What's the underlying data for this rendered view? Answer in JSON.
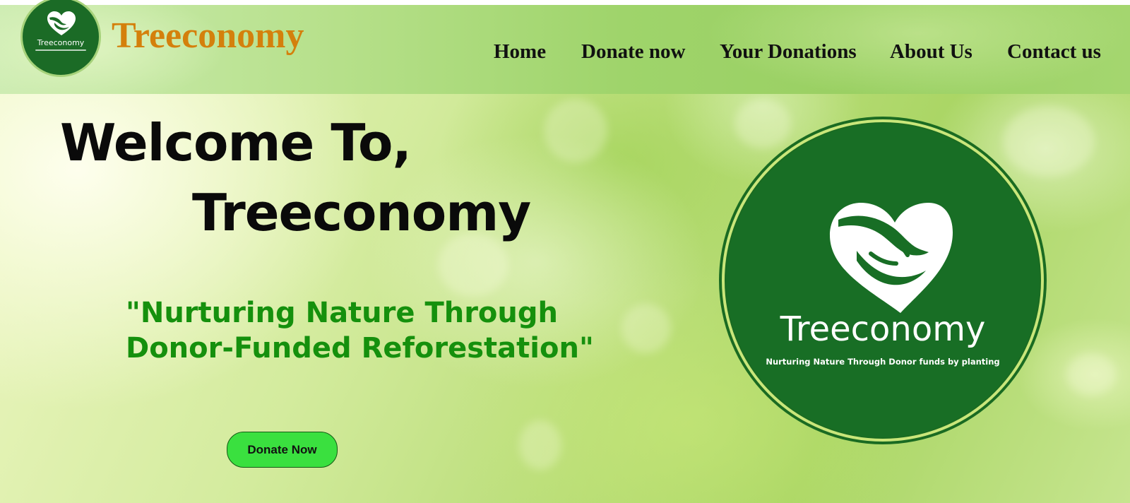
{
  "header": {
    "brand": "Treeconomy",
    "logo_text": "Treeconomy",
    "logo_icon": "heart-hands-icon",
    "nav": [
      {
        "label": "Home"
      },
      {
        "label": "Donate now"
      },
      {
        "label": "Your Donations"
      },
      {
        "label": "About Us"
      },
      {
        "label": "Contact us"
      }
    ]
  },
  "hero": {
    "welcome_line1": "Welcome To,",
    "welcome_line2": "Treeconomy",
    "tagline_line1": "\"Nurturing Nature Through",
    "tagline_line2": "Donor-Funded Reforestation\"",
    "cta_label": "Donate Now"
  },
  "big_logo": {
    "name": "Treeconomy",
    "subtitle": "Nurturing Nature Through Donor funds by planting",
    "icon": "heart-hands-icon"
  },
  "colors": {
    "brand_orange": "#d4800c",
    "tagline_green": "#15900d",
    "logo_green": "#186e25",
    "button_green": "#3ae03f"
  }
}
